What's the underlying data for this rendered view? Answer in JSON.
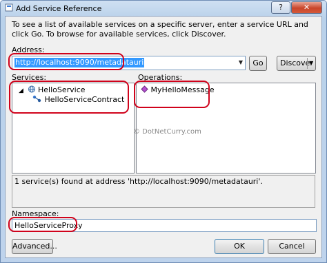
{
  "window": {
    "title": "Add Service Reference",
    "help_label": "?",
    "close_label": "✕"
  },
  "intro_text": "To see a list of available services on a specific server, enter a service URL and click Go. To browse for available services, click Discover.",
  "address": {
    "label": "Address:",
    "value": "http://localhost:9090/metadatauri",
    "go_label": "Go",
    "discover_label": "Discover"
  },
  "services": {
    "label": "Services:",
    "items": [
      {
        "label": "HelloService",
        "icon": "service-icon"
      },
      {
        "label": "HelloServiceContract",
        "icon": "contract-icon"
      }
    ]
  },
  "operations": {
    "label": "Operations:",
    "items": [
      {
        "label": "MyHelloMessage",
        "icon": "operation-icon"
      }
    ]
  },
  "watermark": "© DotNetCurry.com",
  "status_text": "1 service(s) found at address 'http://localhost:9090/metadatauri'.",
  "namespace": {
    "label": "Namespace:",
    "value": "HelloServiceProxy"
  },
  "footer": {
    "advanced_label": "Advanced...",
    "ok_label": "OK",
    "cancel_label": "Cancel"
  },
  "colors": {
    "highlight": "#d0021b",
    "selection": "#3399ff"
  }
}
